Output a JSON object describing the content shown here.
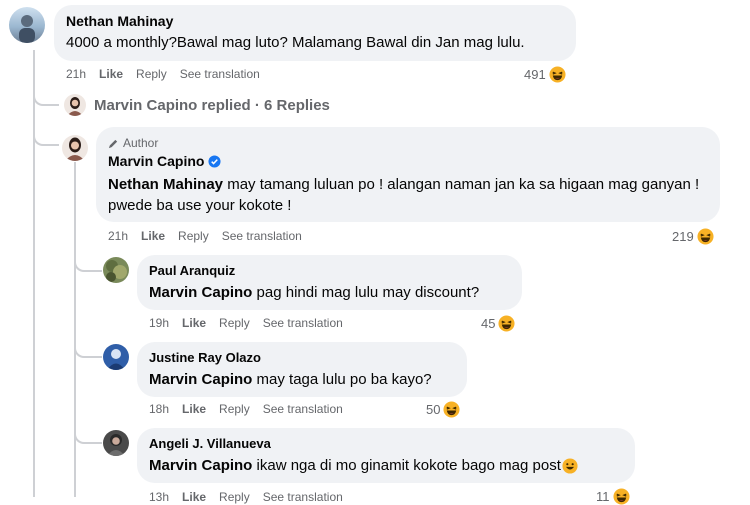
{
  "comment1": {
    "author": "Nethan Mahinay",
    "text": "4000 a monthly?Bawal mag luto? Malamang Bawal din Jan mag lulu.",
    "time": "21h",
    "like": "Like",
    "reply": "Reply",
    "translation": "See translation",
    "reactions": "491"
  },
  "replies_summary": "Marvin Capino replied · 6 Replies",
  "reply1": {
    "badge": "Author",
    "author": "Marvin Capino",
    "mention": "Nethan Mahinay",
    "text": " may tamang luluan po ! alangan naman jan ka sa higaan mag ganyan ! pwede ba use your kokote !",
    "time": "21h",
    "like": "Like",
    "reply": "Reply",
    "translation": "See translation",
    "reactions": "219"
  },
  "reply2": {
    "author": "Paul Aranquiz",
    "mention": "Marvin Capino",
    "text": " pag hindi mag lulu may discount?",
    "time": "19h",
    "like": "Like",
    "reply": "Reply",
    "translation": "See translation",
    "reactions": "45"
  },
  "reply3": {
    "author": "Justine Ray Olazo",
    "mention": "Marvin Capino",
    "text": " may taga lulu po ba kayo?",
    "time": "18h",
    "like": "Like",
    "reply": "Reply",
    "translation": "See translation",
    "reactions": "50"
  },
  "reply4": {
    "author": "Angeli J. Villanueva",
    "mention": "Marvin Capino",
    "text": " ikaw nga di mo ginamit kokote bago mag post",
    "time": "13h",
    "like": "Like",
    "reply": "Reply",
    "translation": "See translation",
    "reactions": "11"
  },
  "colors": {
    "bubble": "#f0f2f5",
    "meta": "#65676b",
    "verified": "#1877f2",
    "thread_line": "#ced0d4"
  }
}
